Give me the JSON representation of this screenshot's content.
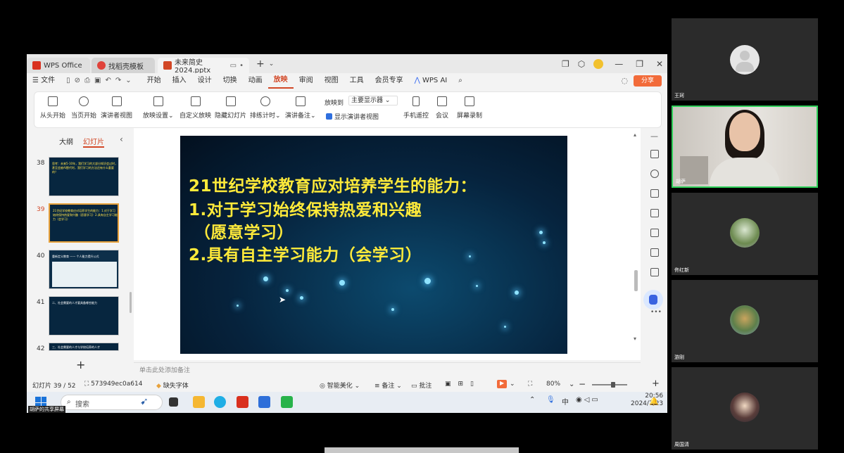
{
  "window": {
    "tabs": [
      {
        "label": "WPS Office",
        "icon": "wps-logo-icon",
        "color": "#d9301e"
      },
      {
        "label": "找稻壳模板",
        "icon": "docer-icon",
        "color": "#e0433b"
      },
      {
        "label": "未来简史 2024.pptx",
        "icon": "ppt-file-icon",
        "color": "#d24726"
      }
    ]
  },
  "menubar": {
    "file": "文件",
    "items": [
      "开始",
      "插入",
      "设计",
      "切换",
      "动画",
      "放映",
      "审阅",
      "视图",
      "工具",
      "会员专享"
    ],
    "active": "放映",
    "wps_ai": "WPS AI",
    "share": "分享"
  },
  "ribbon": {
    "from_start": "从头开始",
    "from_current": "当页开始",
    "presenter_view": "演讲者视图",
    "slideshow_settings": "放映设置",
    "custom_show": "自定义放映",
    "hide_slide": "隐藏幻灯片",
    "rehearse": "排练计时",
    "speaker_notes": "演讲备注",
    "show_on_label": "放映到",
    "show_on_value": "主要显示器",
    "show_presenter_view": "显示演讲者视图",
    "phone_remote": "手机遥控",
    "meeting": "会议",
    "screen_record": "屏幕录制"
  },
  "left_pane": {
    "tab_outline": "大纲",
    "tab_slides": "幻灯片",
    "thumbnails": [
      {
        "num": "38",
        "text": "思考：未来5-10年，我们学习的大部分知识会过时，甚至会被AI替代时，我们学习的方法还有什么重要的？"
      },
      {
        "num": "39",
        "text": "21世纪学校教育应对培养学生的能力：1.对于学习始终保持热爱和兴趣（愿意学习）2.具有自主学习能力（会学习）"
      },
      {
        "num": "40",
        "text": "重新定义教育 —— 个人能力提升公式"
      },
      {
        "num": "41",
        "text": "二、社会需要的人才要具备哪些能力"
      },
      {
        "num": "42",
        "text": "三、社会需要的人才与学校培养的人才"
      }
    ]
  },
  "slide": {
    "lines": [
      "21世纪学校教育应对培养学生的能力：",
      "1.对于学习始终保持热爱和兴趣",
      "（愿意学习）",
      "2.具有自主学习能力（会学习）"
    ]
  },
  "notes_placeholder": "单击此处添加备注",
  "statusbar": {
    "slide_pos": "幻灯片 39 / 52",
    "doc_id": "573949ec0a614",
    "missing_font": "缺失字体",
    "smart_beautify": "智能美化",
    "notes": "备注",
    "comments": "批注",
    "zoom": "80%"
  },
  "taskbar": {
    "search_placeholder": "搜索",
    "ime": "中",
    "time": "20:56",
    "date": "2024/7/23",
    "sharer": "胡萨的共享屏幕"
  },
  "participants": [
    {
      "name": "王珂",
      "type": "default-avatar"
    },
    {
      "name": "胡萨",
      "type": "video"
    },
    {
      "name": "佟红新",
      "type": "photo"
    },
    {
      "name": "游刚",
      "type": "photo"
    },
    {
      "name": "周国清",
      "type": "photo"
    }
  ]
}
